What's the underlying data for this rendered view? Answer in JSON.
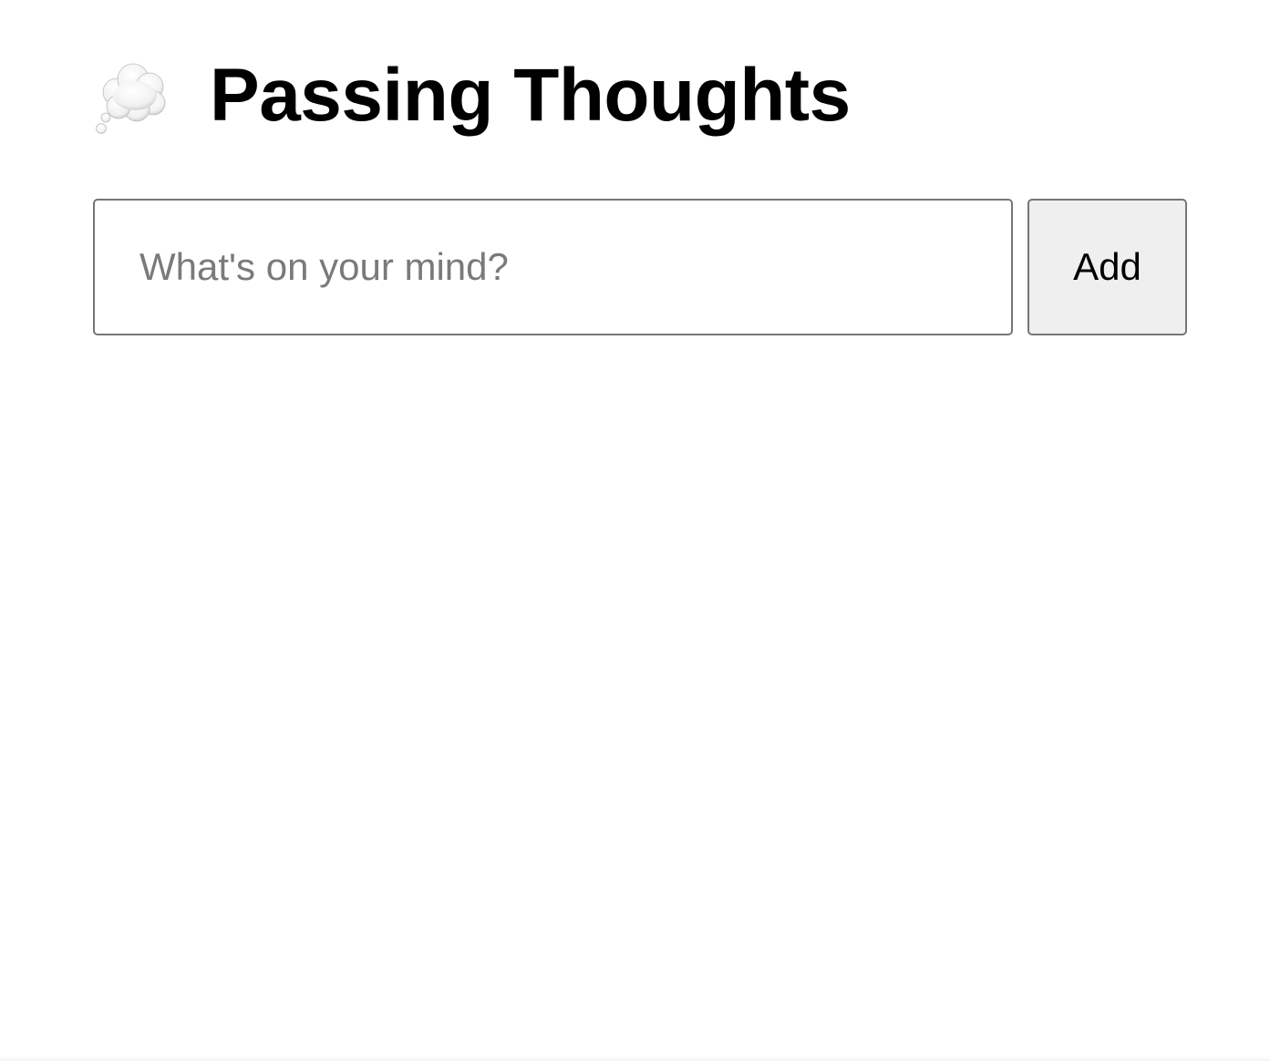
{
  "header": {
    "icon": "thought-balloon-icon",
    "title": "Passing Thoughts"
  },
  "form": {
    "input_value": "",
    "input_placeholder": "What's on your mind?",
    "add_label": "Add"
  },
  "colors": {
    "border": "#767676",
    "button_bg": "#efefef",
    "placeholder": "#7a7a7a",
    "text": "#000000",
    "background": "#ffffff"
  }
}
